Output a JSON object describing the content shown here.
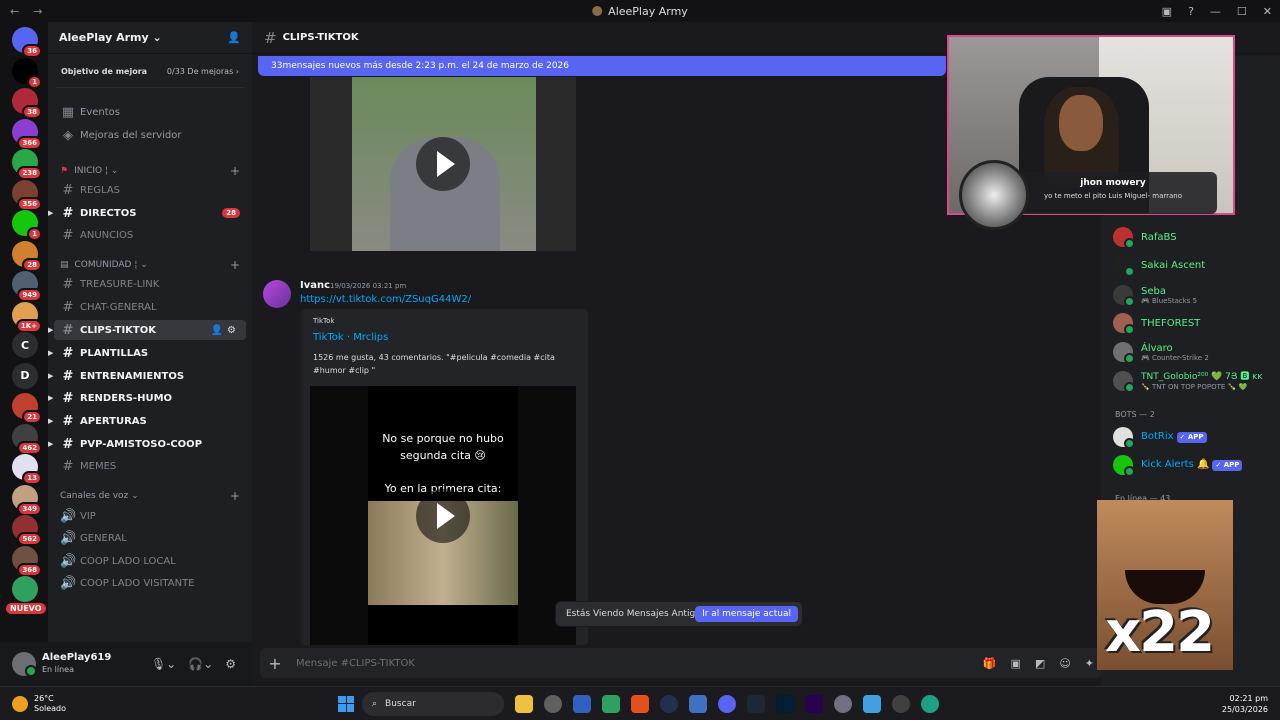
{
  "window": {
    "title": "AleePlay Army",
    "controls": [
      "—",
      "☐",
      "✕"
    ]
  },
  "servers": [
    {
      "label": "",
      "badge": "36",
      "color": "#5865f2"
    },
    {
      "label": "",
      "badge": "1",
      "color": "#000000"
    },
    {
      "label": "",
      "badge": "38",
      "color": "#b0293a"
    },
    {
      "label": "",
      "badge": "366",
      "color": "#8a3fd0"
    },
    {
      "label": "",
      "badge": "238",
      "color": "#2aa848"
    },
    {
      "label": "",
      "badge": "356",
      "color": "#7a4030"
    },
    {
      "label": "",
      "badge": "1",
      "color": "#16c60c"
    },
    {
      "label": "",
      "badge": "28",
      "color": "#d08030"
    },
    {
      "label": "",
      "badge": "949",
      "color": "#506070"
    },
    {
      "label": "",
      "badge": "1K+",
      "color": "#e0a050"
    },
    {
      "label": "C",
      "badge": "",
      "color": "#2b2d31"
    },
    {
      "label": "D",
      "badge": "",
      "color": "#2b2d31"
    },
    {
      "label": "",
      "badge": "21",
      "color": "#c04030"
    },
    {
      "label": "",
      "badge": "462",
      "color": "#404040"
    },
    {
      "label": "",
      "badge": "13",
      "color": "#e0e0f0"
    },
    {
      "label": "",
      "badge": "349",
      "color": "#c0a080"
    },
    {
      "label": "",
      "badge": "562",
      "color": "#903030"
    },
    {
      "label": "",
      "badge": "368",
      "color": "#705040"
    },
    {
      "label": "",
      "badge": "",
      "color": "#30a060"
    }
  ],
  "new_badge": "NUEVO",
  "guild": {
    "name": "AleePlay Army",
    "boost_label": "Objetivo de mejora",
    "boost_count": "0/33 De mejoras"
  },
  "sidebar": {
    "events": "Eventos",
    "boosts": "Mejoras del servidor",
    "categories": [
      {
        "name": "INICIO"
      },
      {
        "name": "COMUNIDAD"
      },
      {
        "name": "Canales de voz"
      }
    ],
    "channels": [
      {
        "name": "REGLAS"
      },
      {
        "name": "DIRECTOS",
        "badge": "28"
      },
      {
        "name": "ANUNCIOS"
      },
      {
        "name": "TREASURE-LINK"
      },
      {
        "name": "CHAT-GENERAL"
      },
      {
        "name": "CLIPS-TIKTOK"
      },
      {
        "name": "PLANTILLAS"
      },
      {
        "name": "ENTRENAMIENTOS"
      },
      {
        "name": "RENDERS-HUMO"
      },
      {
        "name": "APERTURAS"
      },
      {
        "name": "PVP-AMISTOSO-COOP"
      },
      {
        "name": "MEMES"
      }
    ],
    "voice": [
      {
        "name": "VIP"
      },
      {
        "name": "GENERAL"
      },
      {
        "name": "COOP LADO LOCAL"
      },
      {
        "name": "COOP LADO VISITANTE"
      }
    ]
  },
  "user": {
    "name": "AleePlay619",
    "status": "En línea"
  },
  "channel": {
    "name": "CLIPS-TIKTOK",
    "new_messages": "33mensajes nuevos más desde 2:23 p.m. el 24 de marzo de 2026"
  },
  "message": {
    "author": "Ivanc",
    "time": "19/03/2026 03:21 pm",
    "link": "https://vt.tiktok.com/ZSuqG44W2/",
    "embed": {
      "provider": "TikTok",
      "title": "TikTok · Mrclips",
      "description": "1526 me gusta, 43 comentarios. \"#pelicula #comedia #cita #humor #clip \""
    },
    "video_caption_1": "No se porque no hubo segunda cita 😢",
    "video_caption_2": "Yo en la primera cita:"
  },
  "jump": {
    "text": "Estás Viendo Mensajes Antiguos",
    "button": "Ir al mensaje actual"
  },
  "composer": {
    "placeholder": "Mensaje #CLIPS-TIKTOK"
  },
  "members": {
    "online_list": [
      {
        "name": "RafaBS",
        "activity": ""
      },
      {
        "name": "Sakai Ascent",
        "activity": ""
      },
      {
        "name": "Seba",
        "activity": "🎮 BlueStacks 5"
      },
      {
        "name": "THEFOREST",
        "activity": ""
      },
      {
        "name": "Álvaro",
        "activity": "🎮 Counter-Strike 2"
      },
      {
        "name": "TNT_Golobio²⁰⁰ 💚 7Յ 🅱 ᴋᴋ",
        "activity": "🍾 TNT ON TOP POPOTE 🍾 💚"
      }
    ],
    "bots_header": "BOTS — 2",
    "bots": [
      {
        "name": "BotRix",
        "tag": "✓ APP"
      },
      {
        "name": "Kick Alerts 🔔",
        "tag": "✓ APP"
      }
    ],
    "online_header": "En línea — 43"
  },
  "overlay": {
    "alert_name": "jhon mowery",
    "alert_message": "yo te meto el pito Luis Miguel- marrano",
    "meme_text": "x22"
  },
  "taskbar": {
    "temp": "26°C",
    "weather": "Soleado",
    "search": "Buscar",
    "time": "02:21 pm",
    "date": "25/03/2026"
  }
}
